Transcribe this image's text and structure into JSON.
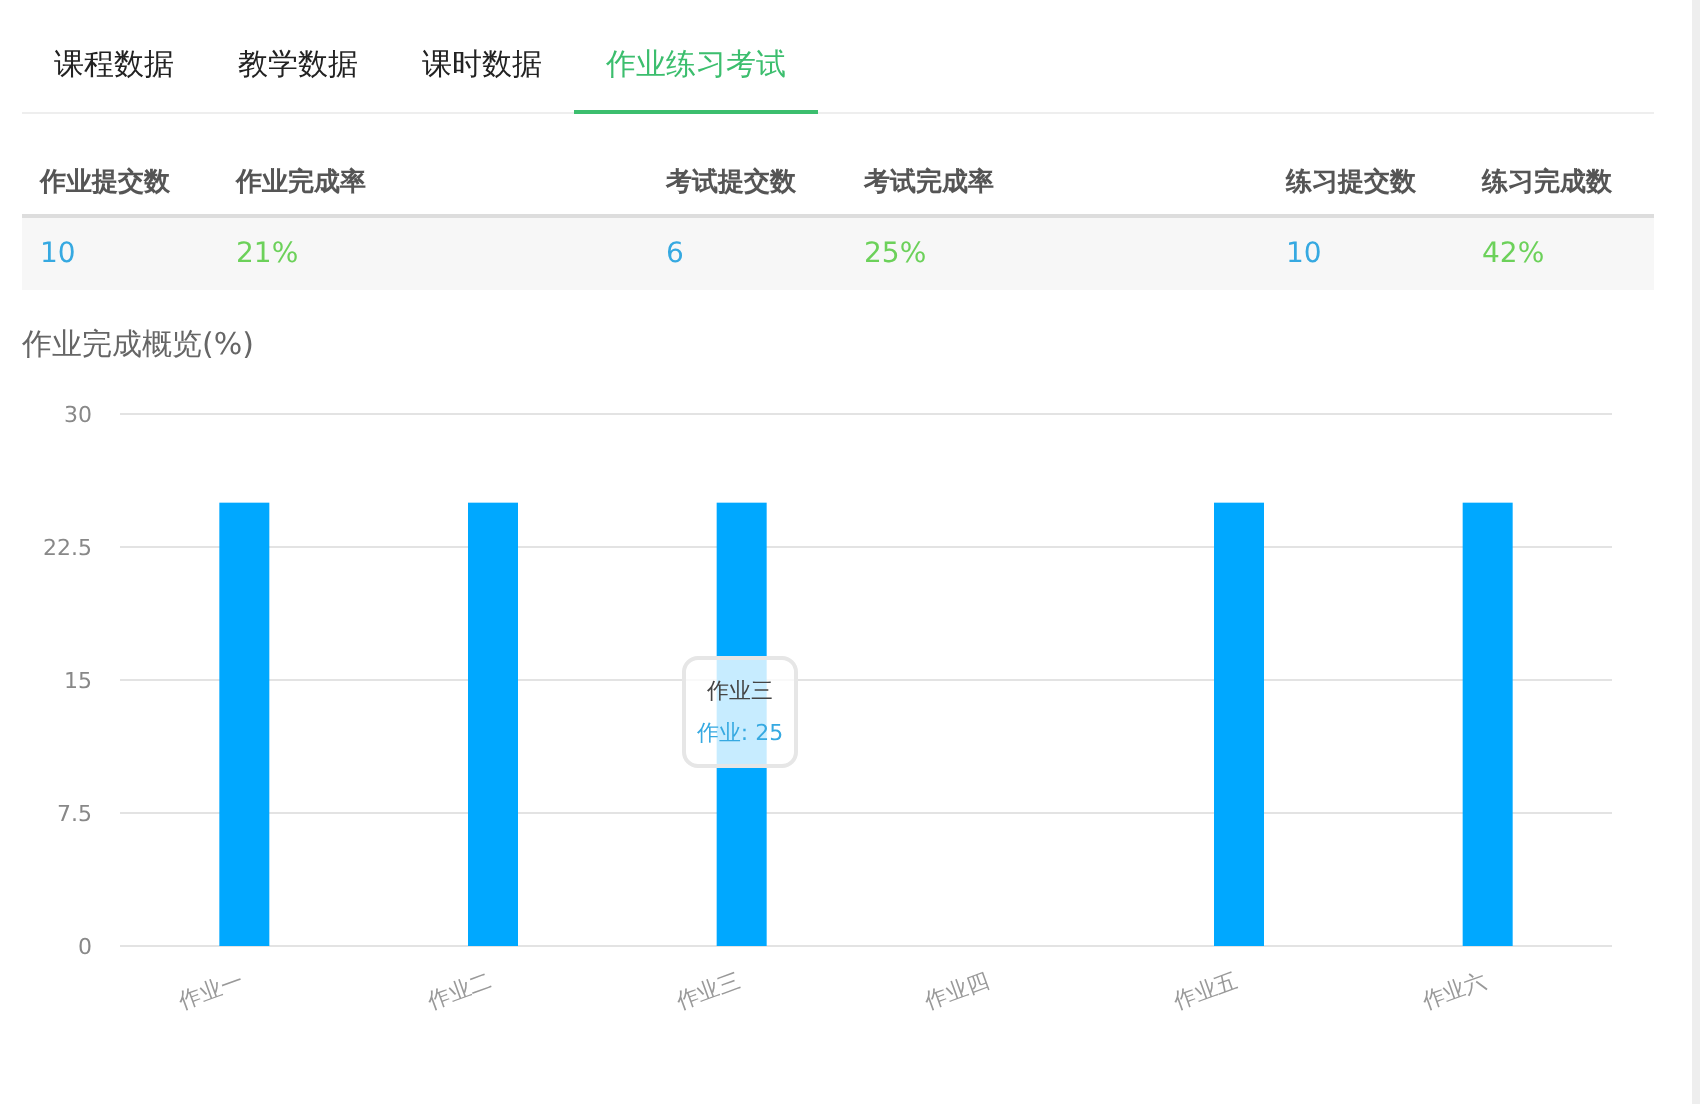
{
  "tabs": [
    {
      "label": "课程数据",
      "selected": false
    },
    {
      "label": "教学数据",
      "selected": false
    },
    {
      "label": "课时数据",
      "selected": false
    },
    {
      "label": "作业练习考试",
      "selected": true
    }
  ],
  "stats_table": {
    "columns": [
      {
        "label": "作业提交数",
        "kind": "count"
      },
      {
        "label": "作业完成率",
        "kind": "rate"
      },
      {
        "label": "考试提交数",
        "kind": "count"
      },
      {
        "label": "考试完成率",
        "kind": "rate"
      },
      {
        "label": "练习提交数",
        "kind": "count"
      },
      {
        "label": "练习完成数",
        "kind": "rate"
      }
    ],
    "rows": [
      [
        "10",
        "21%",
        "6",
        "25%",
        "10",
        "42%"
      ]
    ]
  },
  "chart_title": "作业完成概览(%)",
  "chart": {
    "chart_data": {
      "type": "bar",
      "categories": [
        "作业一",
        "作业二",
        "作业三",
        "作业四",
        "作业五",
        "作业六"
      ],
      "series": [
        {
          "name": "作业",
          "color": "#00a8ff",
          "values": [
            25,
            25,
            25,
            0,
            25,
            25
          ]
        }
      ],
      "ylim": [
        0,
        30
      ],
      "grid": true,
      "yticks": [
        0,
        {
          "value": 7.5,
          "label": "7.5"
        },
        15,
        {
          "value": 22.5,
          "label": "22.5"
        },
        30
      ]
    },
    "tooltip": {
      "title": "作业三",
      "separator": ":",
      "value": "25"
    }
  }
}
